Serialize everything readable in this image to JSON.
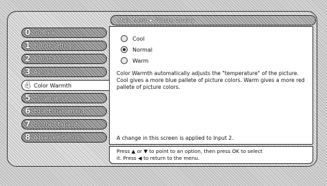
{
  "title_bar": {
    "crumb": "Main Menu",
    "arrow": "▸",
    "page": "Picture Quality"
  },
  "menu": {
    "items": [
      {
        "num": "0",
        "label": "Go Back"
      },
      {
        "num": "1",
        "label": "Picture Settings"
      },
      {
        "num": "2",
        "label": "Picture Presets"
      },
      {
        "num": "3",
        "label": "Auto Color"
      },
      {
        "num": "4",
        "label": "Color Warmth"
      },
      {
        "num": "5",
        "label": "Convergence"
      },
      {
        "num": "6",
        "label": "Edge Enhancement"
      },
      {
        "num": "7",
        "label": "Contrast Expand"
      },
      {
        "num": "8",
        "label": "Advanced Settings"
      }
    ],
    "selected_index": 4
  },
  "options": [
    {
      "label": "Cool",
      "checked": false
    },
    {
      "label": "Normal",
      "checked": true
    },
    {
      "label": "Warm",
      "checked": false
    }
  ],
  "description": "Color Warmth automatically adjusts the \"temperature\" of the picture. Cool gives a more blue pallete of picture colors. Warm gives a more red pallete of picture colors.",
  "note": "A change in this screen is applied to Input 2.",
  "help": {
    "line1": "Press ▲ or ▼ to point to an option, then press OK to select",
    "line2": "it. Press ◀ to return to the menu."
  }
}
